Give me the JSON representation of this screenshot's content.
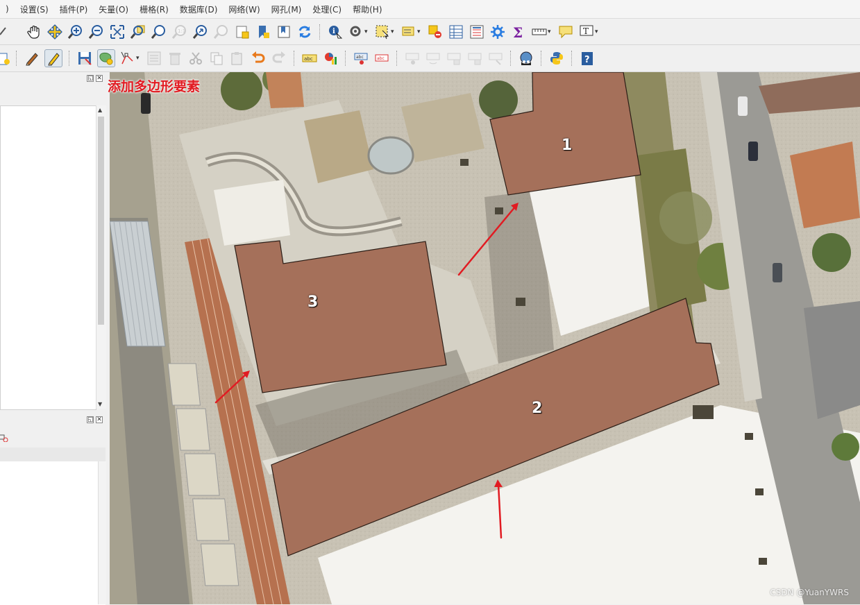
{
  "menu": {
    "items": [
      ")",
      "设置(S)",
      "插件(P)",
      "矢量(O)",
      "栅格(R)",
      "数据库(D)",
      "网络(W)",
      "网孔(M)",
      "处理(C)",
      "帮助(H)"
    ]
  },
  "toolbar_top": {
    "icons": [
      "pan-map-icon",
      "pan-to-selection-icon",
      "zoom-in-icon",
      "zoom-out-icon",
      "zoom-full-icon",
      "zoom-to-selection-icon",
      "zoom-to-layer-icon",
      "zoom-native-resolution-icon",
      "zoom-last-icon",
      "zoom-next-icon",
      "new-map-view-icon",
      "new-bookmark-icon",
      "show-bookmarks-icon",
      "refresh-icon",
      "identify-icon",
      "run-feature-action-icon",
      "select-features-icon",
      "select-by-value-icon",
      "deselect-all-icon",
      "attribute-table-icon",
      "statistical-summary-icon",
      "field-calculator-icon",
      "sum-icon",
      "measure-icon",
      "annotation-icon",
      "text-annotation-icon"
    ]
  },
  "toolbar_bottom": {
    "icons": [
      "current-edits-icon",
      "toggle-editing-icon",
      "save-edits-icon",
      "add-polygon-feature-icon",
      "vertex-tool-icon",
      "modify-attributes-icon",
      "delete-selected-icon",
      "cut-features-icon",
      "copy-features-icon",
      "paste-features-icon",
      "undo-icon",
      "redo-icon",
      "label-tool-icon",
      "diagram-tool-icon",
      "pin-labels-icon",
      "highlight-labels-icon",
      "move-label-icon",
      "rotate-label-icon",
      "change-label-icon",
      "show-hide-labels-icon",
      "quickmapservices-icon",
      "python-console-icon",
      "help-icon"
    ]
  },
  "annotation": {
    "text": "添加多边形要素",
    "color": "#e11b22"
  },
  "features": [
    {
      "id": "1",
      "label": "1"
    },
    {
      "id": "2",
      "label": "2"
    },
    {
      "id": "3",
      "label": "3"
    }
  ],
  "colors": {
    "polygon_fill": "#a5705a",
    "arrow": "#e11b22"
  },
  "watermark": "CSDN @YuanYWRS"
}
